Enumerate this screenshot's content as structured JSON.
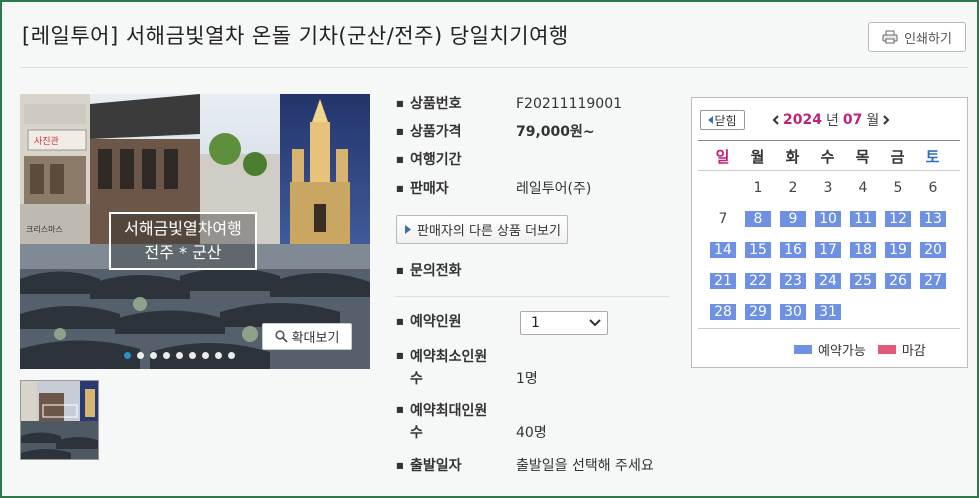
{
  "page": {
    "title": "[레일투어] 서해금빛열차 온돌 기차(군산/전주) 당일치기여행",
    "print_label": "인쇄하기"
  },
  "gallery": {
    "overlay_line1": "서해금빛열차여행",
    "overlay_line2": "전주 * 군산",
    "sign_text": "사진관",
    "sign_text2": "크리스마스",
    "zoom_label": "확대보기",
    "dot_count": 9,
    "active_dot": 0
  },
  "info": {
    "product_no_label": "상품번호",
    "product_no": "F20211119001",
    "price_label": "상품가격",
    "price": "79,000원~",
    "period_label": "여행기간",
    "seller_label": "판매자",
    "seller": "레일투어(주)",
    "seller_more_label": "판매자의 다른 상품 더보기",
    "contact_label": "문의전화",
    "people_label": "예약인원",
    "people_value": "1",
    "min_label_1": "예약최소인원",
    "min_label_2": "수",
    "min_value": "1명",
    "max_label_1": "예약최대인원",
    "max_label_2": "수",
    "max_value": "40명",
    "depart_label": "출발일자",
    "depart_value": "출발일을 선택해 주세요"
  },
  "calendar": {
    "close_label": "닫힘",
    "year": "2024",
    "year_unit": "년",
    "month": "07",
    "month_unit": "월",
    "weekdays": [
      "일",
      "월",
      "화",
      "수",
      "목",
      "금",
      "토"
    ],
    "weeks": [
      [
        null,
        "1",
        "2",
        "3",
        "4",
        "5",
        "6"
      ],
      [
        "7",
        "8",
        "9",
        "10",
        "11",
        "12",
        "13"
      ],
      [
        "14",
        "15",
        "16",
        "17",
        "18",
        "19",
        "20"
      ],
      [
        "21",
        "22",
        "23",
        "24",
        "25",
        "26",
        "27"
      ],
      [
        "28",
        "29",
        "30",
        "31",
        null,
        null,
        null
      ]
    ],
    "available_days": [
      "8",
      "9",
      "10",
      "11",
      "12",
      "13",
      "14",
      "15",
      "16",
      "17",
      "18",
      "19",
      "20",
      "21",
      "22",
      "23",
      "24",
      "25",
      "26",
      "27",
      "28",
      "29",
      "30",
      "31"
    ],
    "legend_available": "예약가능",
    "legend_closed": "마감",
    "colors": {
      "available": "#6e91e3",
      "closed": "#e05a7a",
      "sunday": "#c0217a",
      "saturday": "#2f6fc0"
    }
  }
}
